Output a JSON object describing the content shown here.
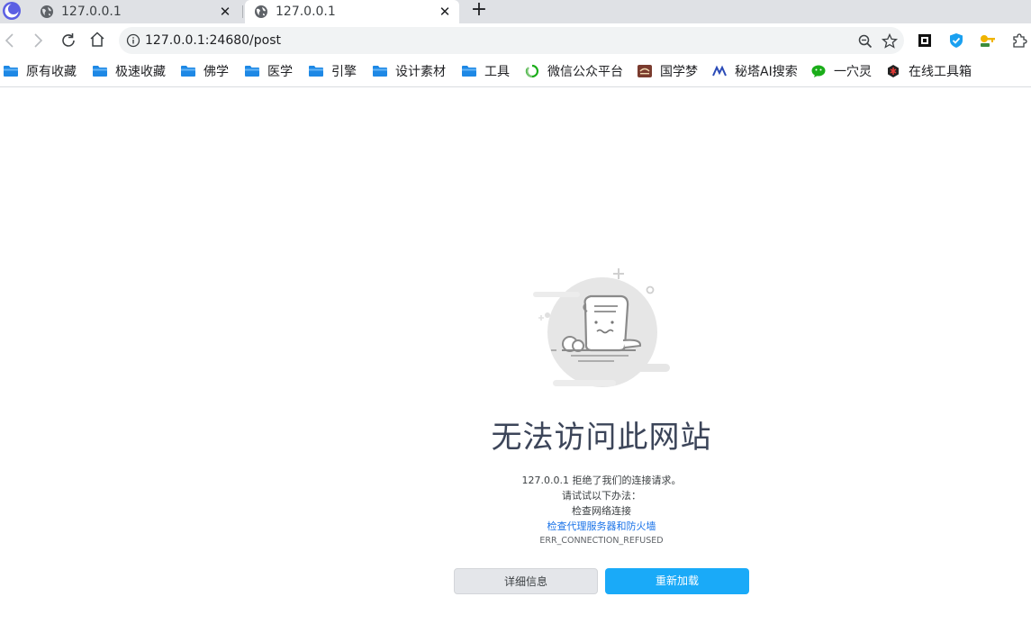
{
  "tabs": [
    {
      "title": "127.0.0.1",
      "active": false,
      "icon": "globe-icon"
    },
    {
      "title": "127.0.0.1",
      "active": true,
      "icon": "globe-icon"
    }
  ],
  "tab_close_glyph": "✕",
  "new_tab_glyph": "+",
  "address_bar": {
    "url": "127.0.0.1:24680/post"
  },
  "bookmarks": [
    {
      "label": "原有收藏",
      "icon": "folder-icon"
    },
    {
      "label": "极速收藏",
      "icon": "folder-icon"
    },
    {
      "label": "佛学",
      "icon": "folder-icon"
    },
    {
      "label": "医学",
      "icon": "folder-icon"
    },
    {
      "label": "引擎",
      "icon": "folder-icon"
    },
    {
      "label": "设计素材",
      "icon": "folder-icon"
    },
    {
      "label": "工具",
      "icon": "folder-icon"
    },
    {
      "label": "微信公众平台",
      "icon": "wechat-mp-icon"
    },
    {
      "label": "国学梦",
      "icon": "guoxuemeng-icon"
    },
    {
      "label": "秘塔AI搜索",
      "icon": "metaso-icon"
    },
    {
      "label": "一穴灵",
      "icon": "wechat-icon"
    },
    {
      "label": "在线工具箱",
      "icon": "toolbox-icon"
    }
  ],
  "error_page": {
    "title": "无法访问此网站",
    "message": "127.0.0.1 拒绝了我们的连接请求。",
    "try_label": "请试试以下办法：",
    "suggestion_1": "检查网络连接",
    "suggestion_2_link": "检查代理服务器和防火墙",
    "error_code": "ERR_CONNECTION_REFUSED",
    "details_button": "详细信息",
    "reload_button": "重新加载"
  },
  "colors": {
    "tabbar_bg": "#dfe1e5",
    "omnibox_bg": "#f1f3f4",
    "folder_blue": "#1e88e5",
    "link_blue": "#1a73e8",
    "reload_button_bg": "#1aaaf8",
    "details_button_bg": "#e4e6ea",
    "title_color": "#3c4559"
  }
}
